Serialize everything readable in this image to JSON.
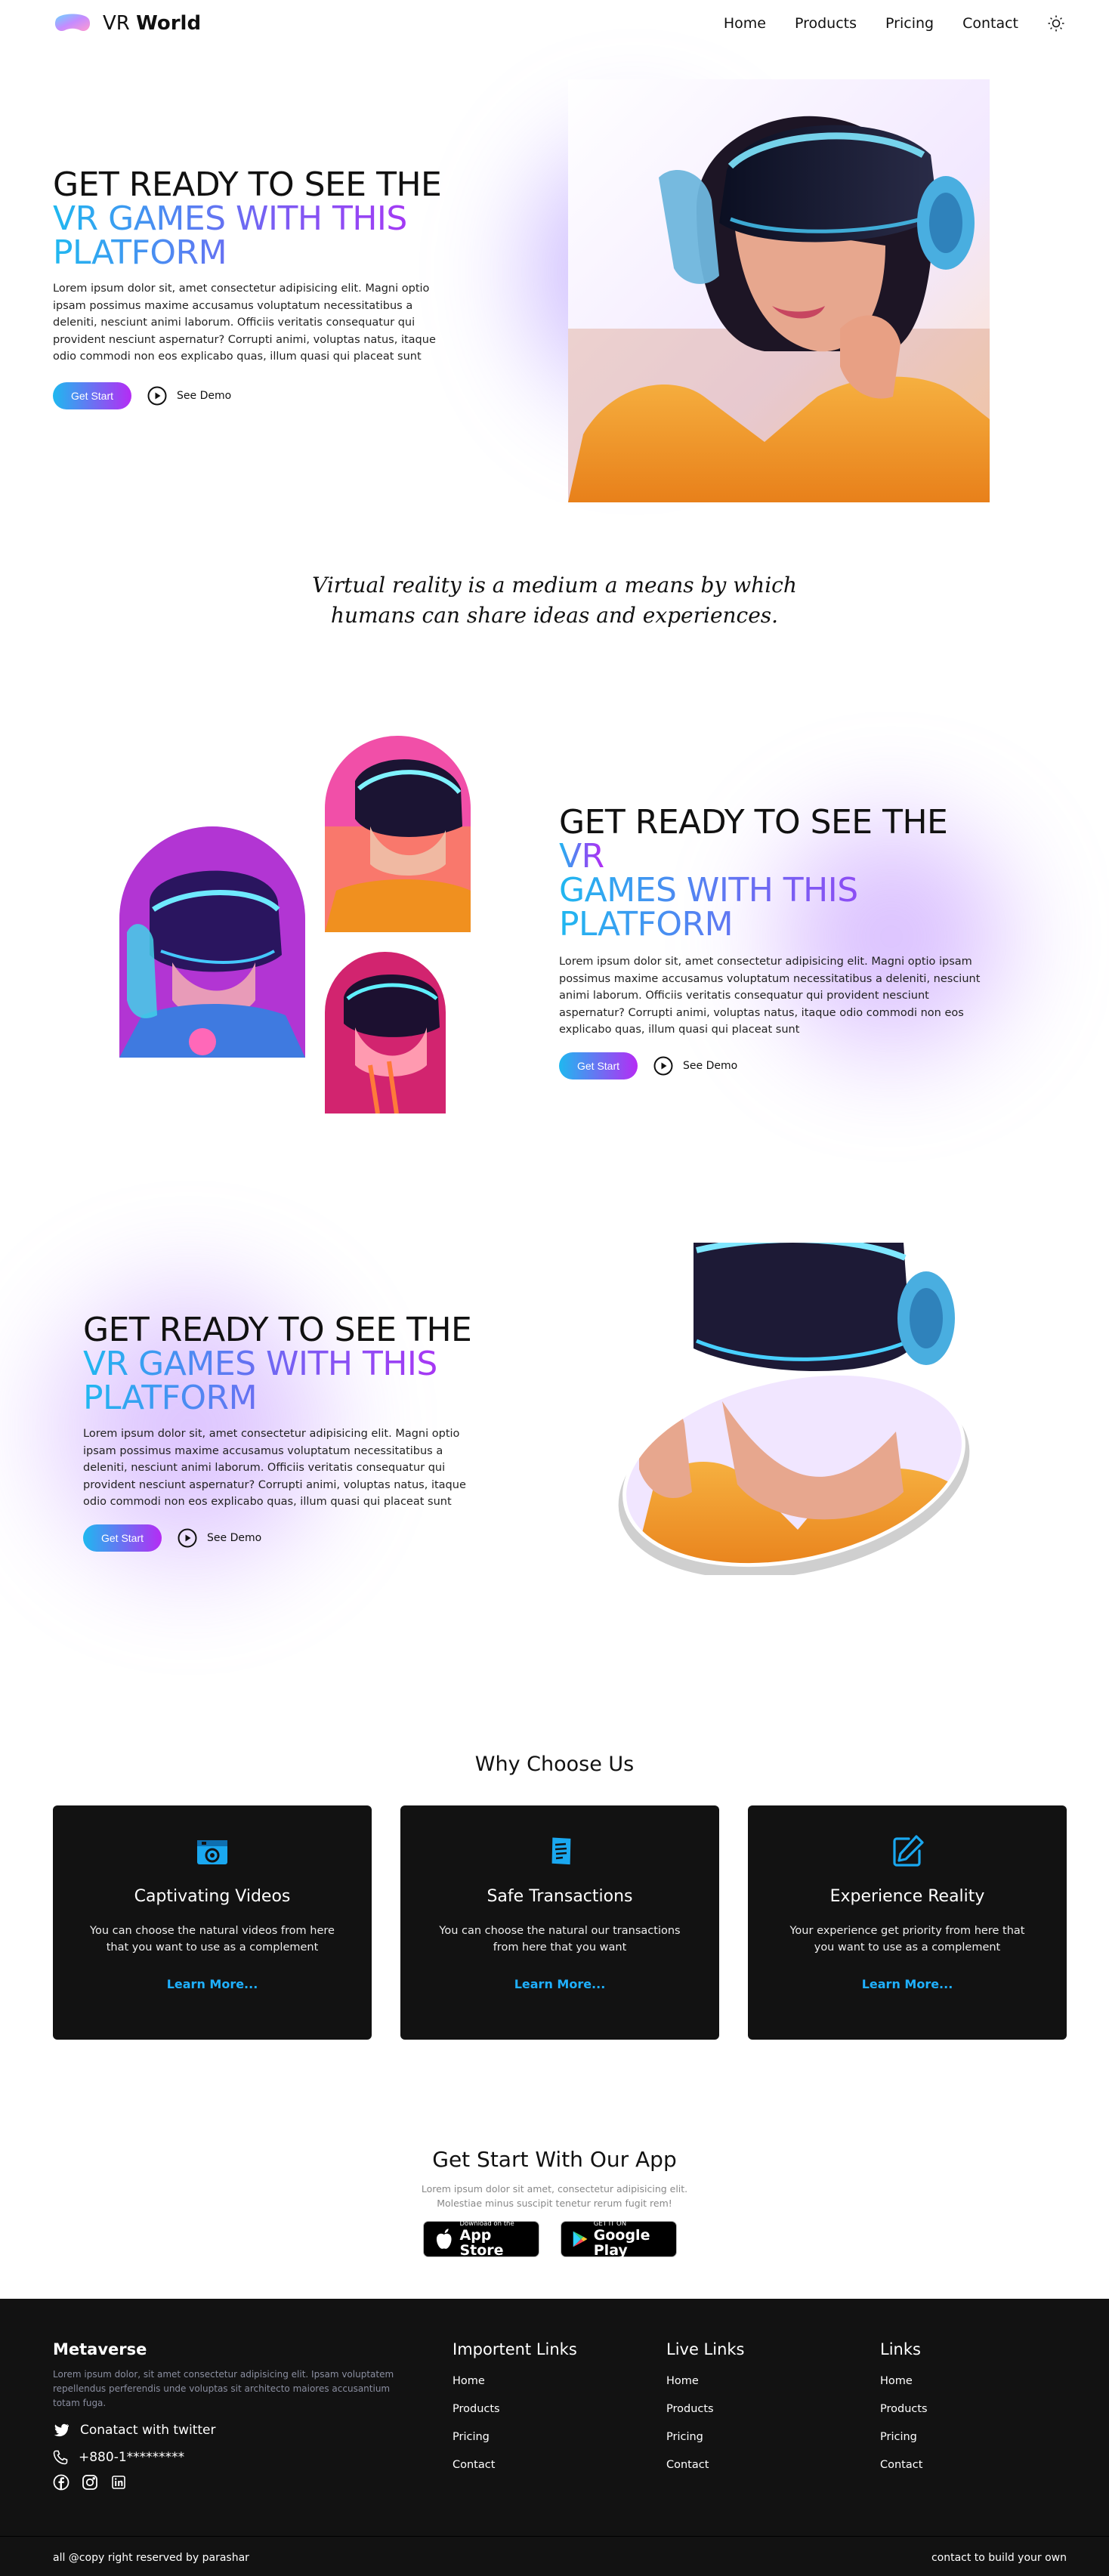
{
  "brand": {
    "light": "VR",
    "bold": "World"
  },
  "nav": {
    "items": [
      "Home",
      "Products",
      "Pricing",
      "Contact"
    ],
    "theme_icon": "sun-icon"
  },
  "hero": {
    "title_line1": "GET READY TO SEE THE",
    "title_line2": "VR GAMES WITH THIS",
    "title_line3": "PLATFORM",
    "body": "Lorem ipsum dolor sit, amet consectetur adipisicing elit. Magni optio ipsam possimus maxime accusamus voluptatum necessitatibus a deleniti, nesciunt animi laborum. Officiis veritatis consequatur qui provident nesciunt aspernatur? Corrupti animi, voluptas natus, itaque odio commodi non eos explicabo quas, illum quasi qui placeat sunt",
    "start_label": "Get Start",
    "demo_label": "See Demo"
  },
  "quote": {
    "line1": "Virtual reality is a medium a means by which",
    "line2": "humans can share ideas and experiences."
  },
  "section2": {
    "title_black": "GET READY TO SEE THE",
    "title_grad_a": "VR",
    "title_grad_b": "GAMES WITH THIS",
    "title_grad_c": "PLATFORM",
    "body": "Lorem ipsum dolor sit, amet consectetur adipisicing elit. Magni optio ipsam possimus maxime accusamus voluptatum necessitatibus a deleniti, nesciunt animi laborum. Officiis veritatis consequatur qui provident nesciunt aspernatur? Corrupti animi, voluptas natus, itaque odio commodi non eos explicabo quas, illum quasi qui placeat sunt",
    "start_label": "Get Start",
    "demo_label": "See Demo"
  },
  "section3": {
    "title_line1": "GET READY TO SEE THE",
    "title_line2": "VR GAMES WITH THIS",
    "title_line3": "PLATFORM",
    "body": "Lorem ipsum dolor sit, amet consectetur adipisicing elit. Magni optio ipsam possimus maxime accusamus voluptatum necessitatibus a deleniti, nesciunt animi laborum. Officiis veritatis consequatur qui provident nesciunt aspernatur? Corrupti animi, voluptas natus, itaque odio commodi non eos explicabo quas, illum quasi qui placeat sunt",
    "start_label": "Get Start",
    "demo_label": "See Demo"
  },
  "why": {
    "title": "Why Choose Us",
    "cards": [
      {
        "icon": "camera-icon",
        "title": "Captivating Videos",
        "text": "You can choose the natural videos from here that you want to use as a complement",
        "link": "Learn More..."
      },
      {
        "icon": "document-icon",
        "title": "Safe Transactions",
        "text": "You can choose the natural our transactions from here that you want",
        "link": "Learn More..."
      },
      {
        "icon": "edit-icon",
        "title": "Experience Reality",
        "text": "Your experience get priority from here that you want to use as a complement",
        "link": "Learn More..."
      }
    ]
  },
  "app": {
    "title": "Get Start With Our App",
    "sub_line1": "Lorem ipsum dolor sit amet, consectetur adipisicing elit.",
    "sub_line2": "Molestiae minus suscipit tenetur rerum fugit rem!",
    "appstore_small": "Download on the",
    "appstore_big": "App Store",
    "play_small": "GET IT ON",
    "play_big": "Google Play"
  },
  "footer": {
    "brand": "Metaverse",
    "desc": "Lorem ipsum dolor, sit amet consectetur adipisicing elit. Ipsam voluptatem repellendus perferendis unde voluptas sit architecto maiores accusantium totam fuga.",
    "twitter": "Conatact with twitter",
    "phone": "+880-1*********",
    "col1_title": "Importent Links",
    "col2_title": "Live Links",
    "col3_title": "Links",
    "links": [
      "Home",
      "Products",
      "Pricing",
      "Contact"
    ],
    "copyright": "all @copy right reserved by parashar",
    "contact": "contact to build your own"
  },
  "colors": {
    "accent_blue": "#1fb8f0",
    "accent_purple": "#b42cf5",
    "dark": "#121212",
    "link_blue": "#1fb0ff"
  }
}
